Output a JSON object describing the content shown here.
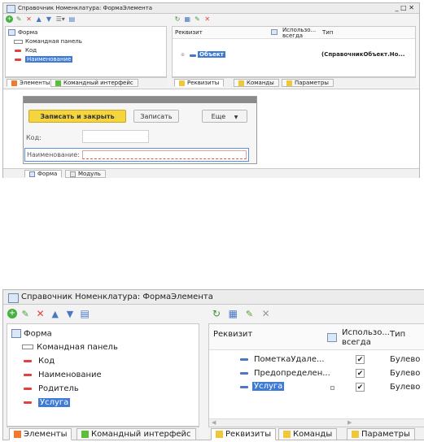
{
  "top": {
    "title": "Справочник Номенклатура: ФормаЭлемента",
    "window_controls": "_ □ ✕",
    "tree": [
      {
        "label": "Форма"
      },
      {
        "label": "Командная панель"
      },
      {
        "label": "Код"
      },
      {
        "label": "Наименование"
      }
    ],
    "left_tabs": [
      "Элементы",
      "Командный интерфейс"
    ],
    "right_header": {
      "col1": "Реквизит",
      "col2": "Использо... всегда",
      "col3": "Тип"
    },
    "right_row": {
      "name": "Объект",
      "type": "(СправочникОбъект.Но..."
    },
    "right_tabs": [
      "Реквизиты",
      "Команды",
      "Параметры"
    ],
    "preview": {
      "save_close": "Записать и закрыть",
      "save": "Записать",
      "more": "Еще",
      "code_label": "Код:",
      "name_label": "Наименование:"
    },
    "bottom_tabs": [
      "Форма",
      "Модуль"
    ]
  },
  "bottom": {
    "title": "Справочник Номенклатура: ФормаЭлемента",
    "tree": [
      {
        "label": "Форма"
      },
      {
        "label": "Командная панель"
      },
      {
        "label": "Код"
      },
      {
        "label": "Наименование"
      },
      {
        "label": "Родитель"
      },
      {
        "label": "Услуга"
      }
    ],
    "left_tabs": [
      "Элементы",
      "Командный интерфейс"
    ],
    "right_header": {
      "col1": "Реквизит",
      "col2": "Использо... всегда",
      "col3": "Тип"
    },
    "rows": [
      {
        "name": "ПометкаУдале...",
        "checked": true,
        "type": "Булево"
      },
      {
        "name": "Предопределен...",
        "checked": true,
        "type": "Булево"
      },
      {
        "name": "Услуга",
        "checked": true,
        "type": "Булево"
      }
    ],
    "right_tabs": [
      "Реквизиты",
      "Команды",
      "Параметры"
    ]
  },
  "colors": {
    "accent": "#3d7bd6",
    "tab_green": "#5bbf3a",
    "tab_yellow": "#f0c63a",
    "red_marker": "#e3413b"
  }
}
